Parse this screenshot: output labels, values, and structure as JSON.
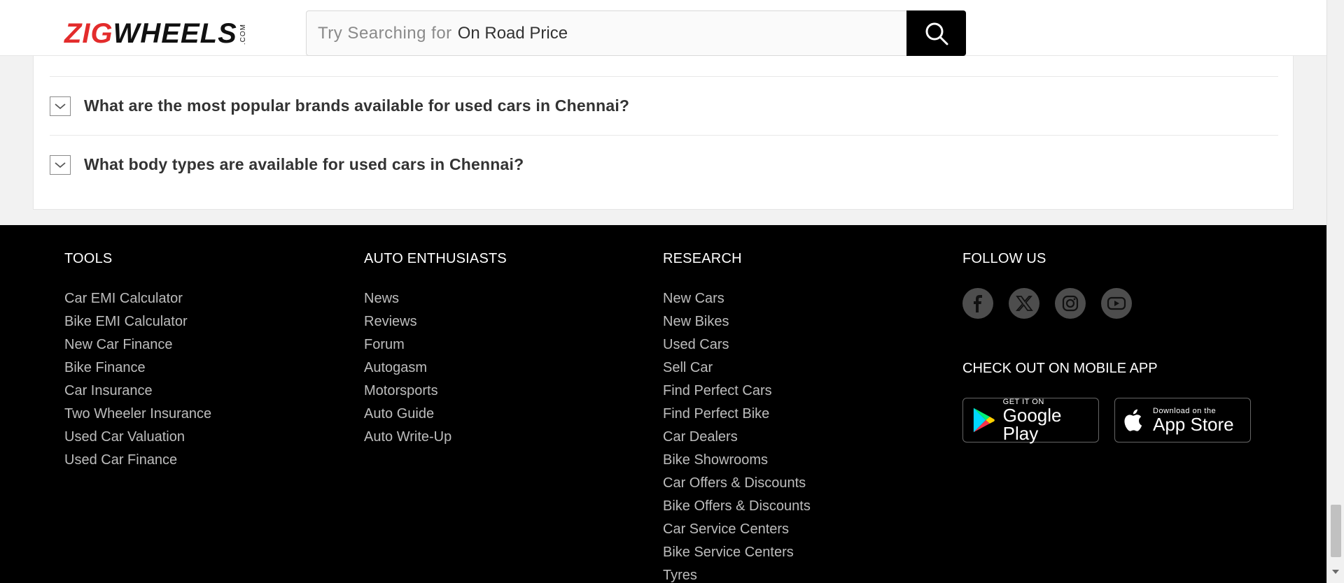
{
  "header": {
    "logo_zig": "ZIG",
    "logo_wheels": "WHEELS",
    "logo_com": ".COM",
    "search_label": "Try Searching for",
    "search_hint": "On Road Price"
  },
  "faq": {
    "items": [
      {
        "question": "What are the most popular brands available for used cars in Chennai?"
      },
      {
        "question": "What body types are available for used cars in Chennai?"
      }
    ]
  },
  "footer": {
    "tools": {
      "title": "TOOLS",
      "links": [
        "Car EMI Calculator",
        "Bike EMI Calculator",
        "New Car Finance",
        "Bike Finance",
        "Car Insurance",
        "Two Wheeler Insurance",
        "Used Car Valuation",
        "Used Car Finance"
      ]
    },
    "auto": {
      "title": "AUTO ENTHUSIASTS",
      "links": [
        "News",
        "Reviews",
        "Forum",
        "Autogasm",
        "Motorsports",
        "Auto Guide",
        "Auto Write-Up"
      ]
    },
    "research": {
      "title": "RESEARCH",
      "links": [
        "New Cars",
        "New Bikes",
        "Used Cars",
        "Sell Car",
        "Find Perfect Cars",
        "Find Perfect Bike",
        "Car Dealers",
        "Bike Showrooms",
        "Car Offers & Discounts",
        "Bike Offers & Discounts",
        "Car Service Centers",
        "Bike Service Centers",
        "Tyres"
      ]
    },
    "follow": {
      "title": "FOLLOW US",
      "icons": [
        "facebook-icon",
        "x-twitter-icon",
        "instagram-icon",
        "youtube-icon"
      ],
      "mobile_title": "CHECK OUT ON MOBILE APP",
      "google_small": "GET IT ON",
      "google_big": "Google Play",
      "apple_small": "Download on the",
      "apple_big": "App Store"
    }
  },
  "colors": {
    "brand_red": "#e32c2c",
    "footer_bg": "#000000",
    "link_gray": "#bdbdbd"
  }
}
